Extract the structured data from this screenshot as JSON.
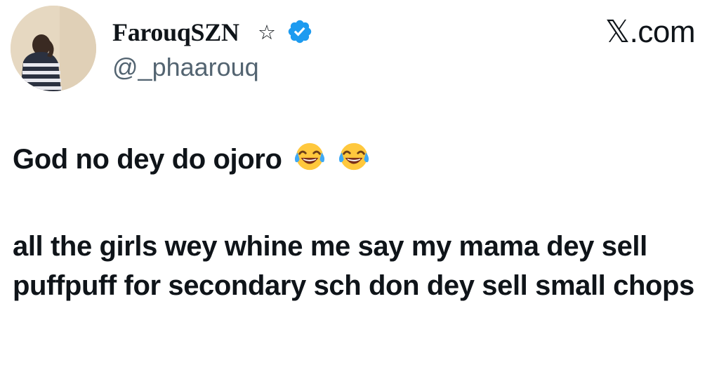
{
  "tweet": {
    "author": {
      "display_name": "FarouqSZN",
      "name_symbol": "☆",
      "handle": "@_phaarouq",
      "avatar_icon": "avatar-photo",
      "verified_icon": "verified-badge-icon"
    },
    "site_label": "𝕏.com",
    "text": {
      "paragraph_1": "God no dey do ojoro",
      "paragraph_1_emojis": [
        "face-with-tears-of-joy",
        "face-with-tears-of-joy"
      ],
      "paragraph_2": "all the girls wey whine me say my mama dey sell puffpuff for secondary sch don dey sell small chops"
    }
  },
  "colors": {
    "text_primary": "#0f1419",
    "text_secondary": "#536471",
    "verified_blue": "#1d9bf0",
    "background": "#ffffff"
  }
}
